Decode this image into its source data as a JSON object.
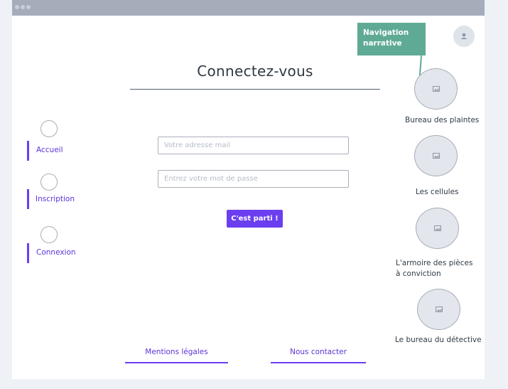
{
  "page": {
    "title": "Connectez-vous"
  },
  "tooltip": {
    "text": "Navigation narrative"
  },
  "nav": {
    "items": [
      {
        "label": "Accueil"
      },
      {
        "label": "Inscription"
      },
      {
        "label": "Connexion"
      }
    ]
  },
  "form": {
    "email_placeholder": "Votre adresse mail",
    "password_placeholder": "Entrez votre mot de passe",
    "submit_label": "C'est parti !"
  },
  "narrative": {
    "items": [
      {
        "label": "Bureau des plaintes"
      },
      {
        "label": "Les cellules"
      },
      {
        "label": "L'armoire des pièces à conviction"
      },
      {
        "label": "Le bureau du détective"
      }
    ]
  },
  "footer": {
    "legal_label": "Mentions légales",
    "contact_label": "Nous contacter"
  },
  "colors": {
    "accent": "#6b3ef0",
    "tooltip": "#5faa95",
    "titlebar": "#a5adbb"
  },
  "icons": [
    "user-icon",
    "image-icon"
  ]
}
